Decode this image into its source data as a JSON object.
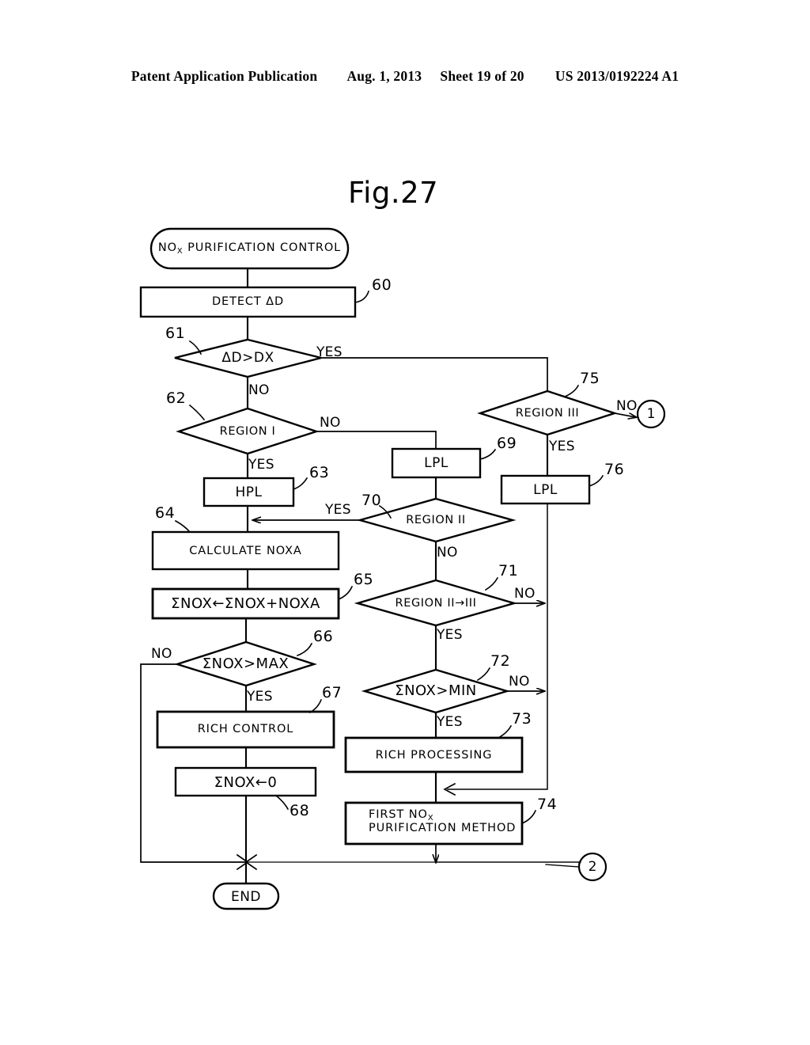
{
  "header": {
    "publication": "Patent Application Publication",
    "date": "Aug. 1, 2013",
    "sheet": "Sheet 19 of 20",
    "patent_number": "US 2013/0192224 A1"
  },
  "figure": {
    "title": "Fig.27"
  },
  "nodes": {
    "start": {
      "label": "NO",
      "label_sub": "X",
      "label_rest": " PURIFICATION CONTROL",
      "shape": "terminal"
    },
    "n60": {
      "label": "DETECT ΔD",
      "ref": "60",
      "shape": "process"
    },
    "n61": {
      "label": "ΔD>DX",
      "ref": "61",
      "shape": "decision"
    },
    "n62": {
      "label": "REGION I",
      "ref": "62",
      "shape": "decision"
    },
    "n63": {
      "label": "HPL",
      "ref": "63",
      "shape": "process"
    },
    "n64": {
      "label": "CALCULATE NOXA",
      "ref": "64",
      "shape": "process"
    },
    "n65": {
      "label": "ΣNOX←ΣNOX+NOXA",
      "ref": "65",
      "shape": "process"
    },
    "n66": {
      "label": "ΣNOX>MAX",
      "ref": "66",
      "shape": "decision"
    },
    "n67": {
      "label": "RICH CONTROL",
      "ref": "67",
      "shape": "process"
    },
    "n68": {
      "label": "ΣNOX←0",
      "ref": "68",
      "shape": "process"
    },
    "n69": {
      "label": "LPL",
      "ref": "69",
      "shape": "process"
    },
    "n70": {
      "label": "REGION II",
      "ref": "70",
      "shape": "decision"
    },
    "n71": {
      "label": "REGION II→III",
      "ref": "71",
      "shape": "decision"
    },
    "n72": {
      "label": "ΣNOX>MIN",
      "ref": "72",
      "shape": "decision"
    },
    "n73": {
      "label": "RICH PROCESSING",
      "ref": "73",
      "shape": "process"
    },
    "n74": {
      "label_line1": "FIRST NO",
      "label_sub": "X",
      "label_line2": "PURIFICATION METHOD",
      "ref": "74",
      "shape": "process"
    },
    "n75": {
      "label": "REGION III",
      "ref": "75",
      "shape": "decision"
    },
    "n76": {
      "label": "LPL",
      "ref": "76",
      "shape": "process"
    },
    "end": {
      "label": "END",
      "shape": "terminal"
    },
    "connector_1": {
      "label": "1",
      "shape": "connector"
    },
    "connector_2": {
      "label": "2",
      "shape": "connector"
    }
  },
  "edge_labels": {
    "e61_yes": "YES",
    "e61_no": "NO",
    "e62_yes": "YES",
    "e62_no": "NO",
    "e70_yes": "YES",
    "e70_no": "NO",
    "e71_no": "NO",
    "e71_yes": "YES",
    "e72_no": "NO",
    "e72_yes": "YES",
    "e66_no": "NO",
    "e66_yes": "YES",
    "e75_no": "NO",
    "e75_yes": "YES"
  },
  "style": {
    "ink": "#000000",
    "paper": "#ffffff"
  }
}
